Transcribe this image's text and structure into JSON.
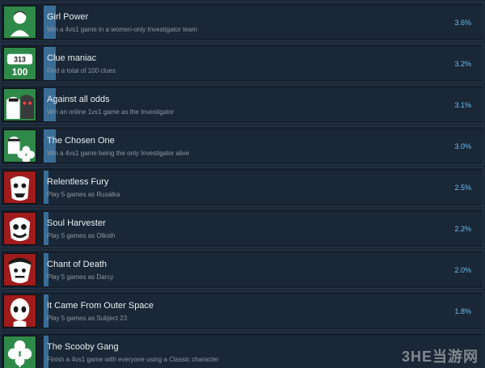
{
  "achievements": [
    {
      "title": "Girl Power",
      "description": "Win a 4vs1 game in a women-only Investigator team",
      "percent": "3.6%",
      "progress": 0.027,
      "icon": "woman-portrait-icon",
      "theme": "green"
    },
    {
      "title": "Clue maniac",
      "description": "Find a total of 100 clues",
      "percent": "3.2%",
      "progress": 0.027,
      "icon": "clue-100-icon",
      "theme": "green"
    },
    {
      "title": "Against all odds",
      "description": "Win an online 1vs1 game as the Investigator",
      "percent": "3.1%",
      "progress": 0.027,
      "icon": "investigator-vs-monster-icon",
      "theme": "green"
    },
    {
      "title": "The Chosen One",
      "description": "Win a 4vs1 game being the only Investigator alive",
      "percent": "3.0%",
      "progress": 0.027,
      "icon": "investigator-clover-icon",
      "theme": "green"
    },
    {
      "title": "Relentless Fury",
      "description": "Play 5 games as Rusalka",
      "percent": "2.5%",
      "progress": 0.011,
      "icon": "rusalka-face-icon",
      "theme": "red"
    },
    {
      "title": "Soul Harvester",
      "description": "Play 5 games as Olkoth",
      "percent": "2.2%",
      "progress": 0.011,
      "icon": "olkoth-face-icon",
      "theme": "red"
    },
    {
      "title": "Chant of Death",
      "description": "Play 5 games as Darcy",
      "percent": "2.0%",
      "progress": 0.011,
      "icon": "darcy-face-icon",
      "theme": "red"
    },
    {
      "title": "It Came From Outer Space",
      "description": "Play 5 games as Subject 23",
      "percent": "1.8%",
      "progress": 0.011,
      "icon": "alien-face-icon",
      "theme": "red"
    },
    {
      "title": "The Scooby Gang",
      "description": "Finish a 4vs1 game with everyone using a Classic character",
      "percent": "",
      "progress": 0.011,
      "icon": "clover-icon",
      "theme": "green"
    }
  ],
  "watermark": "3HE当游网",
  "colors": {
    "background": "#1b2838",
    "row": "#16202d",
    "progress_fill": "#3a6e97",
    "percent_text": "#67c1f5",
    "green_icon_bg": "#2f8a4a",
    "red_icon_bg": "#a01b1b"
  }
}
